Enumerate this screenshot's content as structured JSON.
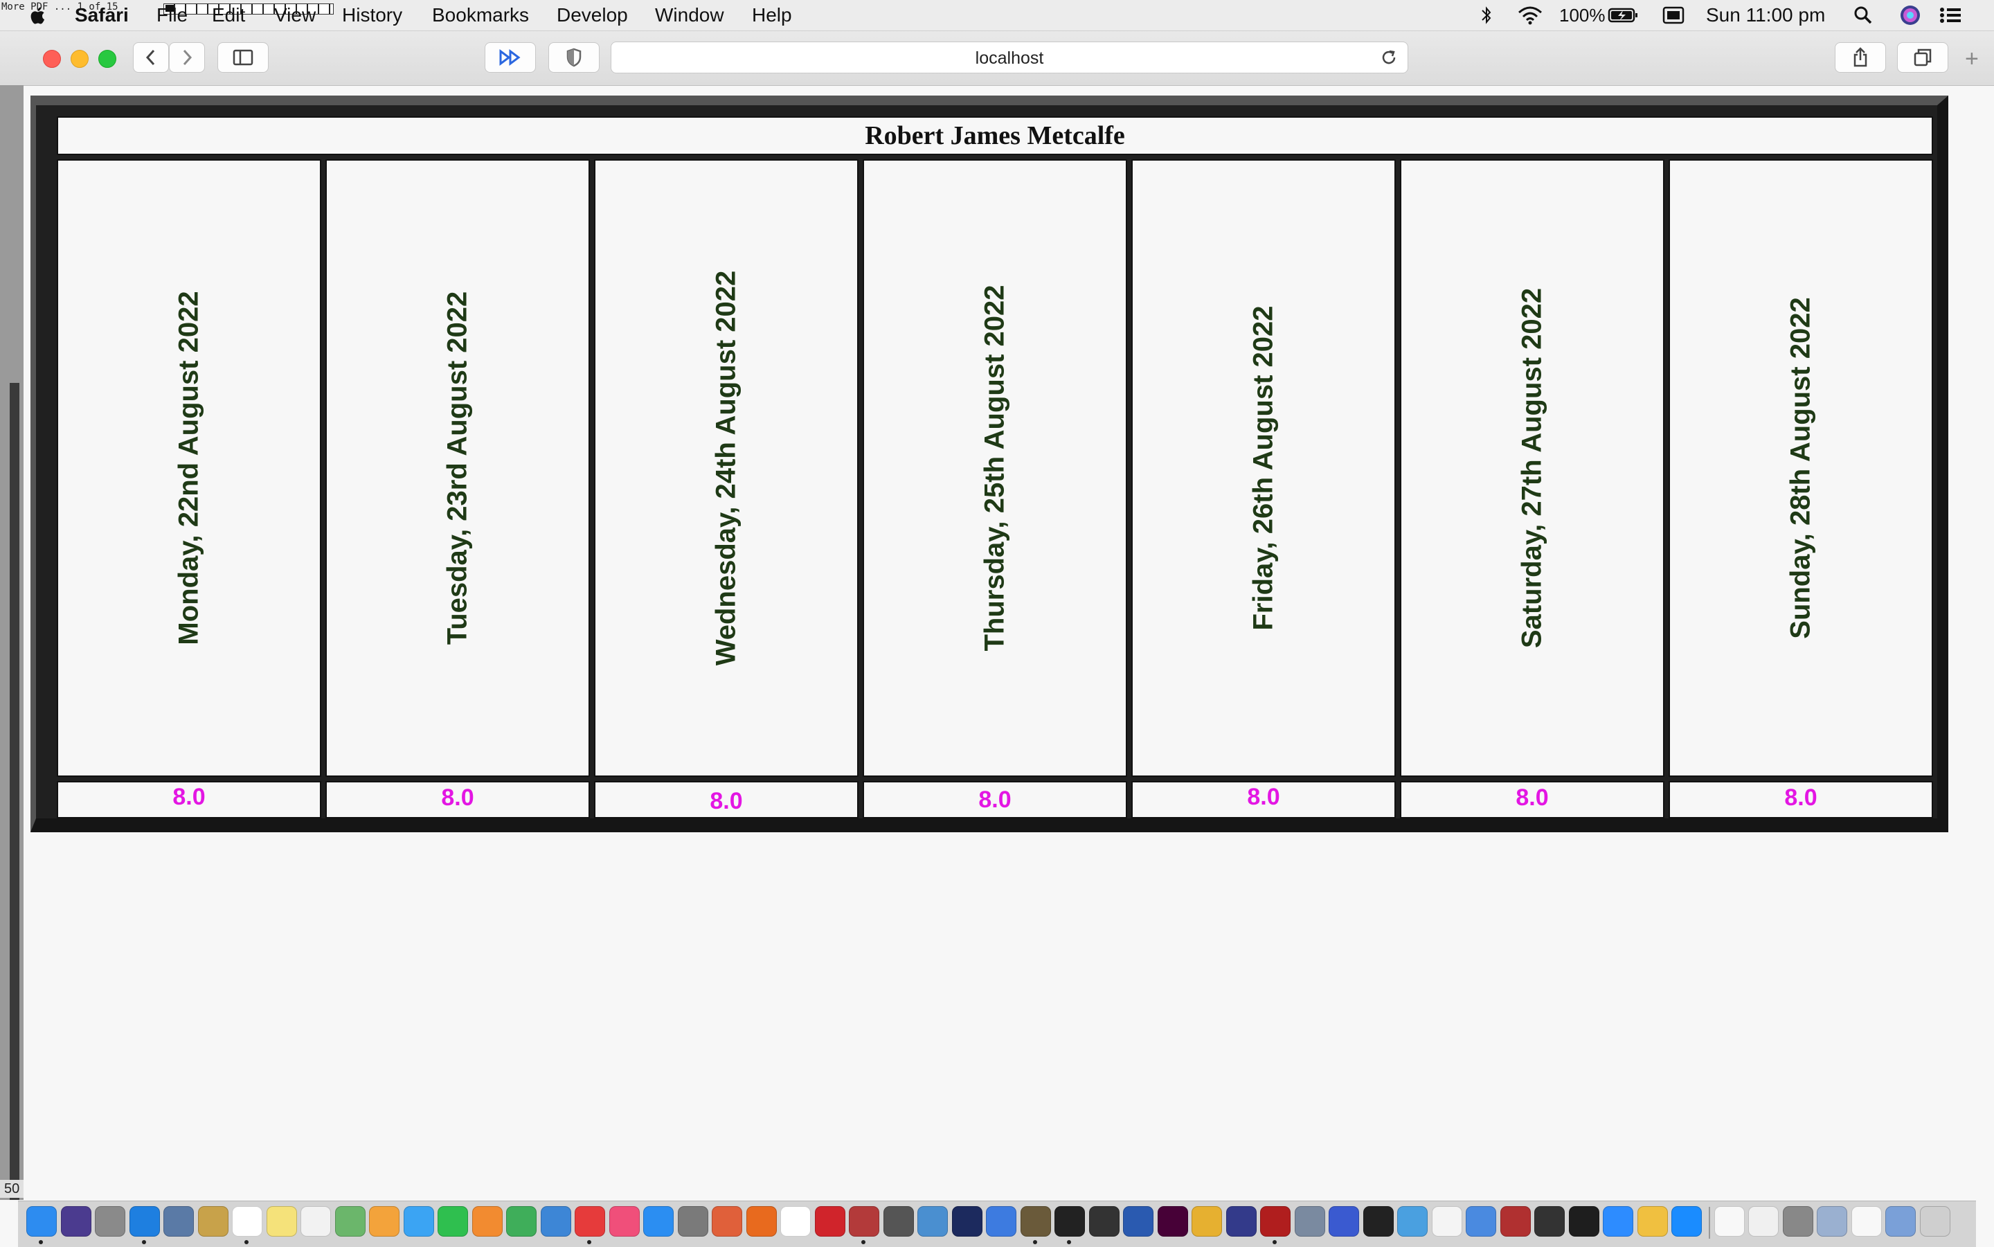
{
  "menubar": {
    "app_name": "Safari",
    "menus": [
      "File",
      "Edit",
      "View",
      "History",
      "Bookmarks",
      "Develop",
      "Window",
      "Help"
    ],
    "tiny_overlay": "More PDF ... 1 of 15",
    "battery": "100%",
    "clock": "Sun 11:00 pm",
    "status_icons": [
      "bluetooth-icon",
      "wifi-icon",
      "battery-icon",
      "keyboard-icon",
      "spotlight-icon",
      "siri-icon",
      "control-center-icon"
    ]
  },
  "browser": {
    "url": "localhost",
    "buttons": [
      "back-button",
      "forward-button",
      "sidebar-button",
      "reader-button",
      "privacy-button",
      "share-button",
      "tabs-button",
      "new-tab-button"
    ]
  },
  "timesheet": {
    "employee_name": "Robert James Metcalfe",
    "days": [
      {
        "label": "Monday, 22nd August 2022",
        "hours": "8.0"
      },
      {
        "label": "Tuesday, 23rd August 2022",
        "hours": "8.0"
      },
      {
        "label": "Wednesday, 24th August 2022",
        "hours": "8.0"
      },
      {
        "label": "Thursday, 25th August 2022",
        "hours": "8.0"
      },
      {
        "label": "Friday, 26th August 2022",
        "hours": "8.0"
      },
      {
        "label": "Saturday, 27th August 2022",
        "hours": "8.0"
      },
      {
        "label": "Sunday, 28th August 2022",
        "hours": "8.0"
      }
    ],
    "colors": {
      "day_text": "#1f3a16",
      "hours_text": "#e316e3",
      "frame": "#202020"
    }
  },
  "page_zoom": "50",
  "dock": {
    "apps": [
      "finder-icon",
      "siri-icon",
      "launchpad-icon",
      "safari-icon",
      "preview-icon",
      "notes-icon",
      "calendar-icon",
      "notes-pad-icon",
      "reminders-icon",
      "maps-icon",
      "photos-icon",
      "messages-icon",
      "facetime-icon",
      "pages-icon",
      "numbers-icon",
      "keynote-icon",
      "news-icon",
      "music-icon",
      "app-store-icon",
      "system-preferences-icon",
      "shortcuts-icon",
      "firefox-icon",
      "chrome-icon",
      "opera-icon",
      "photo-booth-icon",
      "sequel-icon",
      "filezilla-like-icon",
      "photoshop-icon",
      "xcode-icon",
      "gimp-icon",
      "terminal-icon",
      "inkscape-icon",
      "r-icon",
      "xd-icon",
      "color-icon",
      "finalcut-icon",
      "filezilla-icon",
      "disk-icon",
      "headphones-icon",
      "font-icon",
      "box-icon",
      "textedit-icon",
      "folder-icon",
      "brush-icon",
      "x11-icon",
      "quicktime-icon",
      "zoom-icon",
      "cyberduck-icon",
      "messenger-icon",
      "document-icon",
      "document-icon",
      "utilities-icon",
      "downloads-icon",
      "document-icon",
      "applications-icon",
      "trash-icon"
    ]
  }
}
